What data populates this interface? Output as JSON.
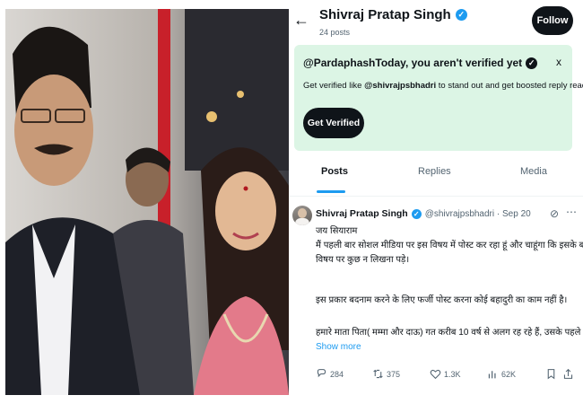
{
  "profile": {
    "back_icon": "arrow-left-icon",
    "name": "Shivraj Pratap Singh",
    "posts_count": "24 posts",
    "follow_label": "Follow"
  },
  "banner": {
    "title": "@PardaphashToday, you aren't verified yet",
    "close_label": "x",
    "desc_prefix": "Get verified like ",
    "desc_handle": "@shivrajpsbhadri",
    "desc_suffix": " to stand out and get boosted reply reach.",
    "button_label": "Get Verified"
  },
  "tabs": [
    {
      "label": "Posts",
      "active": true
    },
    {
      "label": "Replies",
      "active": false
    },
    {
      "label": "Media",
      "active": false
    }
  ],
  "tweet": {
    "name": "Shivraj Pratap Singh",
    "handle": "@shivrajpsbhadri · Sep 20",
    "lines": [
      "जय सियाराम",
      "मैं पहली बार सोशल मीडिया पर इस विषय में पोस्ट कर रहा हूं और चाहूंगा कि इसके बाद इस",
      "विषय पर कुछ न लिखना पड़े।",
      "",
      "इस प्रकार बदनाम करने के लिए फर्जी पोस्ट करना कोई बहादुरी का काम नहीं है।",
      "",
      "हमारे माता पिता( मम्मा और दाऊ) गत करीब 10 वर्ष से अलग रह रहे हैं, उसके पहले कुछ"
    ],
    "show_more": "Show more",
    "replies": "284",
    "reposts": "375",
    "likes": "1.3K",
    "views": "62K"
  },
  "colors": {
    "accent": "#1d9bf0",
    "banner_bg": "#dcf5e5",
    "text": "#0f1419",
    "secondary": "#536471"
  }
}
